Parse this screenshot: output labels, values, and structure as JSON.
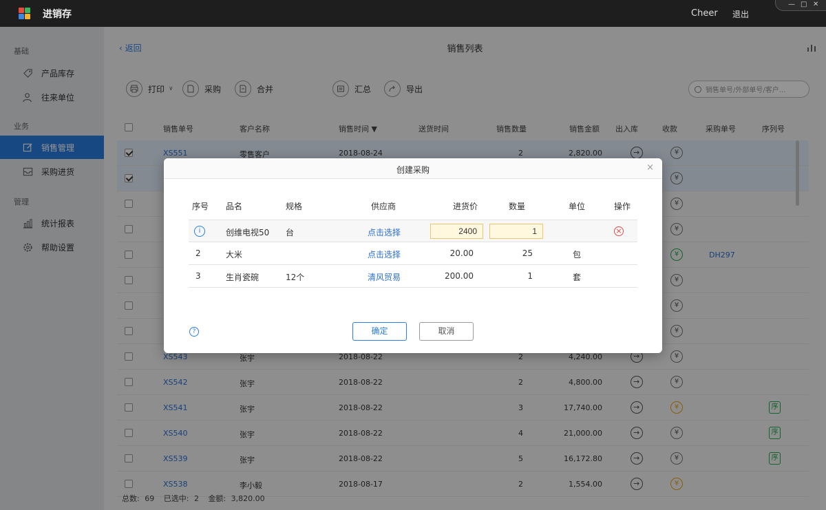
{
  "app": {
    "title": "进销存",
    "user": "Cheer",
    "logout": "退出",
    "window_controls": [
      "—",
      "□",
      "✕"
    ]
  },
  "sidebar": {
    "groups": [
      {
        "label": "基础",
        "items": [
          {
            "label": "产品库存",
            "icon": "tag-icon"
          },
          {
            "label": "往来单位",
            "icon": "contacts-icon"
          }
        ]
      },
      {
        "label": "业务",
        "items": [
          {
            "label": "销售管理",
            "icon": "edit-icon",
            "active": true
          },
          {
            "label": "采购进货",
            "icon": "inbox-icon"
          }
        ]
      },
      {
        "label": "管理",
        "items": [
          {
            "label": "统计报表",
            "icon": "bar-chart-icon"
          },
          {
            "label": "帮助设置",
            "icon": "gear-icon"
          }
        ]
      }
    ]
  },
  "topbar": {
    "back": "返回",
    "title": "销售列表"
  },
  "toolbar": {
    "print": "打印",
    "purchase": "采购",
    "merge": "合并",
    "summary": "汇总",
    "export": "导出",
    "search_placeholder": "销售单号/外部单号/客户..."
  },
  "table": {
    "headers": [
      "销售单号",
      "客户名称",
      "销售时间 ▼",
      "送货时间",
      "销售数量",
      "销售金额",
      "出入库",
      "收款",
      "采购单号",
      "序列号"
    ],
    "rows": [
      {
        "no": "XS551",
        "customer": "零售客户",
        "date": "2018-08-24",
        "qty": "2",
        "amount": "2,820.00",
        "payment": "grey",
        "purchase_no": "",
        "serial": false,
        "checked": true
      },
      {
        "no": "",
        "customer": "",
        "date": "",
        "qty": "",
        "amount": "",
        "payment": "grey",
        "purchase_no": "",
        "serial": false,
        "checked": true
      },
      {
        "no": "",
        "customer": "",
        "date": "",
        "qty": "",
        "amount": "",
        "payment": "grey",
        "purchase_no": "",
        "serial": false,
        "checked": false
      },
      {
        "no": "",
        "customer": "",
        "date": "",
        "qty": "",
        "amount": "",
        "payment": "grey",
        "purchase_no": "",
        "serial": false,
        "checked": false
      },
      {
        "no": "",
        "customer": "",
        "date": "",
        "qty": "",
        "amount": "",
        "payment": "green",
        "purchase_no": "DH297",
        "serial": false,
        "checked": false
      },
      {
        "no": "",
        "customer": "",
        "date": "",
        "qty": "",
        "amount": "",
        "payment": "grey",
        "purchase_no": "",
        "serial": false,
        "checked": false
      },
      {
        "no": "",
        "customer": "",
        "date": "",
        "qty": "",
        "amount": "",
        "payment": "grey",
        "purchase_no": "",
        "serial": false,
        "checked": false
      },
      {
        "no": "",
        "customer": "",
        "date": "",
        "qty": "",
        "amount": "",
        "payment": "grey",
        "purchase_no": "",
        "serial": false,
        "checked": false
      },
      {
        "no": "XS543",
        "customer": "张宇",
        "date": "2018-08-22",
        "qty": "2",
        "amount": "4,240.00",
        "payment": "grey",
        "purchase_no": "",
        "serial": false,
        "checked": false
      },
      {
        "no": "XS542",
        "customer": "张宇",
        "date": "2018-08-22",
        "qty": "2",
        "amount": "4,800.00",
        "payment": "grey",
        "purchase_no": "",
        "serial": false,
        "checked": false
      },
      {
        "no": "XS541",
        "customer": "张宇",
        "date": "2018-08-22",
        "qty": "3",
        "amount": "17,740.00",
        "payment": "orange",
        "purchase_no": "",
        "serial": true,
        "checked": false
      },
      {
        "no": "XS540",
        "customer": "张宇",
        "date": "2018-08-22",
        "qty": "4",
        "amount": "21,000.00",
        "payment": "grey",
        "purchase_no": "",
        "serial": true,
        "checked": false
      },
      {
        "no": "XS539",
        "customer": "张宇",
        "date": "2018-08-22",
        "qty": "5",
        "amount": "16,172.80",
        "payment": "grey",
        "purchase_no": "",
        "serial": true,
        "checked": false
      },
      {
        "no": "XS538",
        "customer": "李小毅",
        "date": "2018-08-17",
        "qty": "2",
        "amount": "1,554.00",
        "payment": "orange",
        "purchase_no": "",
        "serial": false,
        "checked": false
      }
    ],
    "yen_symbol": "¥",
    "serial_symbol": "序"
  },
  "footer": {
    "total_label": "总数:",
    "total": "69",
    "selected_label": "已选中:",
    "selected": "2",
    "amount_label": "金额:",
    "amount": "3,820.00"
  },
  "dialog": {
    "title": "创建采购",
    "close": "×",
    "headers": [
      "序号",
      "品名",
      "规格",
      "供应商",
      "进货价",
      "数量",
      "单位",
      "操作"
    ],
    "rows": [
      {
        "index": "i",
        "name": "创维电视50",
        "spec": "台",
        "supplier": "点击选择",
        "price": "2400",
        "qty": "1",
        "unit": ""
      },
      {
        "index": "2",
        "name": "大米",
        "spec": "",
        "supplier": "点击选择",
        "price": "20.00",
        "qty": "25",
        "unit": "包"
      },
      {
        "index": "3",
        "name": "生肖瓷碗",
        "spec": "12个",
        "supplier": "清风贸易",
        "price": "200.00",
        "qty": "1",
        "unit": "套"
      }
    ],
    "delete_symbol": "×",
    "help_symbol": "?",
    "ok": "确定",
    "cancel": "取消"
  },
  "colors": {
    "accent": "#2a7de1",
    "titlebar": "#1e1e1e",
    "sidebar": "#e4e7eb",
    "input_bg": "#fff8df",
    "danger": "#e24a4a",
    "success": "#23a94e",
    "warning": "#e8a21a"
  }
}
